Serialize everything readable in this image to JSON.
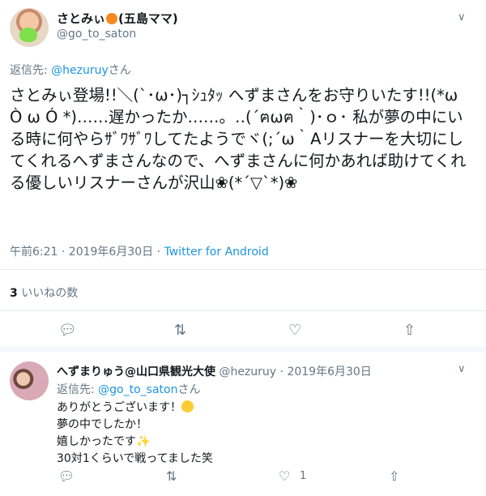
{
  "tweet": {
    "author_name": "さとみぃ",
    "author_name_suffix": "(五島ママ)",
    "author_handle": "@go_to_saton",
    "reply_prefix": "返信先: ",
    "reply_to_handle": "@hezuruy",
    "reply_suffix": "さん",
    "body": "さとみぃ登場!!＼(`･ω･)┐ｼｭﾀｯ へずまさんをお守りいたす!!(*ω Ò ω Ó *)……遅かったか……。‥(´ฅωฅ｀)･ｏ･ 私が夢の中にいる時に何やらｻﾞﾜｻﾞﾜしてたようでヾ(;´ω｀Aリスナーを大切にしてくれるへずまさんなので、へずまさんに何かあれば助けてくれる優しいリスナーさんが沢山❀(*´▽`*)❀",
    "time": "午前6:21 · 2019年6月30日 · ",
    "client": "Twitter for Android",
    "likes_count": "3",
    "likes_label": " いいねの数"
  },
  "reply": {
    "author_name": "へずまりゅう@山口県観光大使",
    "author_handle": "@hezuruy",
    "date": "2019年6月30日",
    "reply_prefix": "返信先: ",
    "reply_to_handle": "@go_to_saton",
    "reply_suffix": "さん",
    "line1": "ありがとうございます！",
    "line2": "夢の中でしたか！",
    "line3": "嬉しかったです",
    "line4": "30対1くらいで戦ってました笑",
    "likes_count": "1"
  },
  "icons": {
    "chevron": "chevron-down-icon",
    "reply": "reply-icon",
    "retweet": "retweet-icon",
    "like": "heart-icon",
    "share": "share-icon"
  }
}
